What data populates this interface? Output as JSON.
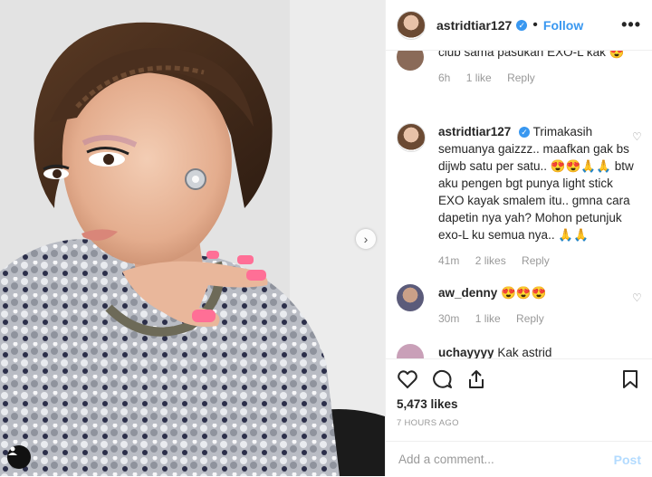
{
  "header": {
    "username": "astridtiar127",
    "separator": "•",
    "follow_label": "Follow",
    "more_label": "•••"
  },
  "comments": [
    {
      "user": "",
      "text": "club sama pasukan EXO-L kak 😍",
      "time": "6h",
      "likes": "1 like",
      "reply": "Reply"
    },
    {
      "user": "astridtiar127",
      "text": "Trimakasih semuanya gaizzz.. maafkan gak bs dijwb satu per satu.. 😍😍🙏🙏 btw aku pengen bgt punya light stick EXO kayak smalem itu.. gmna cara dapetin nya yah? Mohon petunjuk exo-L ku semua nya.. 🙏🙏",
      "time": "41m",
      "likes": "2 likes",
      "reply": "Reply"
    },
    {
      "user": "aw_denny",
      "text": "😍😍😍",
      "time": "30m",
      "likes": "1 like",
      "reply": "Reply"
    },
    {
      "user": "uchayyyy",
      "text": "Kak astrid",
      "time": "",
      "likes": "",
      "reply": ""
    }
  ],
  "actions": {
    "likes": "5,473 likes",
    "time": "7 HOURS AGO",
    "add_placeholder": "Add a comment...",
    "post_label": "Post"
  },
  "photo": {
    "next_label": "›"
  },
  "colors": {
    "accent": "#3897f0",
    "muted": "#999999",
    "post_disabled": "#b3dbff"
  },
  "icons": [
    "heart-icon",
    "comment-icon",
    "share-icon",
    "bookmark-icon",
    "chevron-right-icon",
    "tag-person-icon",
    "verified-icon",
    "more-icon"
  ]
}
